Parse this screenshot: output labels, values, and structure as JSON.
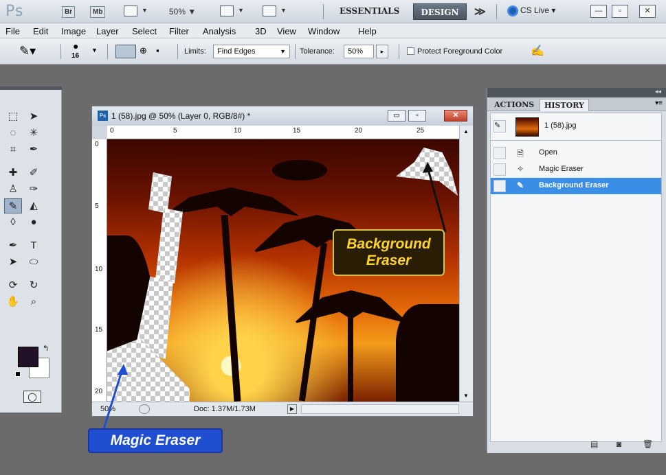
{
  "appbar": {
    "logo": "Ps",
    "bridge": "Br",
    "minibridge": "Mb",
    "zoom": "50% ▼",
    "workspace_essentials": "ESSENTIALS",
    "workspace_design": "DESIGN",
    "more": "≫",
    "cs_live": "CS Live ▾"
  },
  "menu": [
    "File",
    "Edit",
    "Image",
    "Layer",
    "Select",
    "Filter",
    "Analysis",
    "3D",
    "View",
    "Window",
    "Help"
  ],
  "options": {
    "brush_size": "16",
    "limits_label": "Limits:",
    "limits_value": "Find Edges",
    "tolerance_label": "Tolerance:",
    "tolerance_value": "50%",
    "protect_label": "Protect Foreground Color"
  },
  "document": {
    "title": "1 (58).jpg @ 50% (Layer 0, RGB/8#) *",
    "zoom": "50%",
    "doc_info": "Doc: 1.37M/1.73M",
    "hruler": [
      "0",
      "5",
      "10",
      "15",
      "20",
      "25"
    ],
    "vruler": [
      "0",
      "5",
      "10",
      "15",
      "20"
    ]
  },
  "callouts": {
    "background_eraser_line1": "Background",
    "background_eraser_line2": "Eraser",
    "magic_eraser": "Magic Eraser"
  },
  "panel": {
    "tab_actions": "ACTIONS",
    "tab_history": "HISTORY",
    "snapshot": "1 (58).jpg",
    "items": [
      {
        "label": "Open",
        "icon": "document-icon"
      },
      {
        "label": "Magic Eraser",
        "icon": "magic-eraser-icon"
      },
      {
        "label": "Background Eraser",
        "icon": "background-eraser-icon",
        "selected": true
      }
    ]
  },
  "colors": {
    "foreground": "#231029",
    "background": "#ffffff",
    "history_selected": "#3b8ee6",
    "callout_magic": "#1f4fd0",
    "callout_bg_text": "#ffd42a"
  }
}
